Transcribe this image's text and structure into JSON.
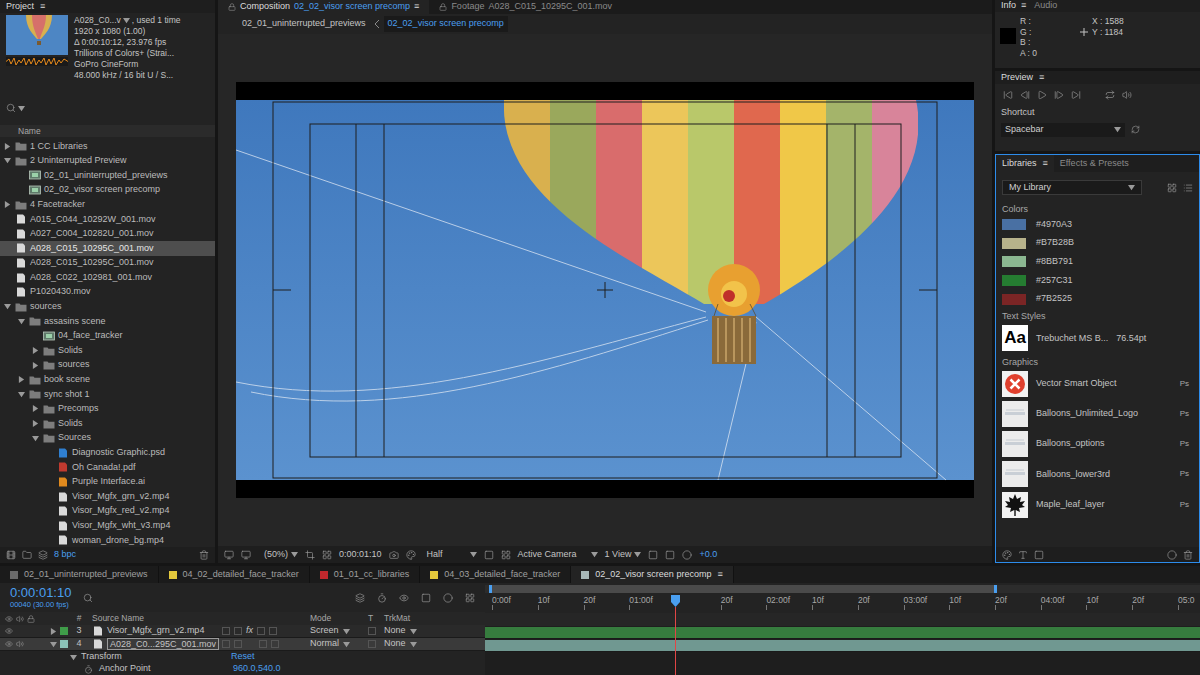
{
  "project": {
    "title": "Project",
    "menu": "≡",
    "preview": {
      "name": "A028_C0...v",
      "usage": ", used 1 time",
      "details": [
        "1920 x 1080 (1.00)",
        "Δ 0:00:10:12, 23.976 fps",
        "Trillions of Colors+ (Strai...",
        "GoPro CineForm",
        "48.000 kHz / 16 bit U / S..."
      ]
    },
    "column": "Name",
    "items": [
      {
        "label": "1 CC Libraries",
        "kind": "folder",
        "depth": 0,
        "expanded": false,
        "selected": false
      },
      {
        "label": "2 Uninterrupted Preview",
        "kind": "folder",
        "depth": 0,
        "expanded": true,
        "selected": false
      },
      {
        "label": "02_01_uninterrupted_previews",
        "kind": "comp",
        "depth": 1,
        "expanded": false,
        "selected": false
      },
      {
        "label": "02_02_visor screen precomp",
        "kind": "comp",
        "depth": 1,
        "expanded": false,
        "selected": false
      },
      {
        "label": "4 Facetracker",
        "kind": "folder",
        "depth": 0,
        "expanded": false,
        "selected": false
      },
      {
        "label": "A015_C044_10292W_001.mov",
        "kind": "footage",
        "depth": 0,
        "expanded": false,
        "selected": false
      },
      {
        "label": "A027_C004_10282U_001.mov",
        "kind": "footage",
        "depth": 0,
        "expanded": false,
        "selected": false
      },
      {
        "label": "A028_C015_10295C_001.mov",
        "kind": "footage",
        "depth": 0,
        "expanded": false,
        "selected": true
      },
      {
        "label": "A028_C015_10295C_001.mov",
        "kind": "footage",
        "depth": 0,
        "expanded": false,
        "selected": false
      },
      {
        "label": "A028_C022_102981_001.mov",
        "kind": "footage",
        "depth": 0,
        "expanded": false,
        "selected": false
      },
      {
        "label": "P1020430.mov",
        "kind": "footage",
        "depth": 0,
        "expanded": false,
        "selected": false
      },
      {
        "label": "sources",
        "kind": "folder",
        "depth": 0,
        "expanded": true,
        "selected": false
      },
      {
        "label": "assasins scene",
        "kind": "folder",
        "depth": 1,
        "expanded": true,
        "selected": false
      },
      {
        "label": "04_face_tracker",
        "kind": "comp",
        "depth": 2,
        "expanded": false,
        "selected": false
      },
      {
        "label": "Solids",
        "kind": "folder",
        "depth": 2,
        "expanded": false,
        "selected": false
      },
      {
        "label": "sources",
        "kind": "folder",
        "depth": 2,
        "expanded": false,
        "selected": false
      },
      {
        "label": "book scene",
        "kind": "folder",
        "depth": 1,
        "expanded": false,
        "selected": false
      },
      {
        "label": "sync shot 1",
        "kind": "folder",
        "depth": 1,
        "expanded": true,
        "selected": false
      },
      {
        "label": "Precomps",
        "kind": "folder",
        "depth": 2,
        "expanded": false,
        "selected": false
      },
      {
        "label": "Solids",
        "kind": "folder",
        "depth": 2,
        "expanded": false,
        "selected": false
      },
      {
        "label": "Sources",
        "kind": "folder",
        "depth": 2,
        "expanded": true,
        "selected": false
      },
      {
        "label": "Diagnostic Graphic.psd",
        "kind": "psd",
        "depth": 3,
        "expanded": false,
        "selected": false
      },
      {
        "label": "Oh Canada!.pdf",
        "kind": "pdf",
        "depth": 3,
        "expanded": false,
        "selected": false
      },
      {
        "label": "Purple Interface.ai",
        "kind": "ai",
        "depth": 3,
        "expanded": false,
        "selected": false
      },
      {
        "label": "Visor_Mgfx_grn_v2.mp4",
        "kind": "footage",
        "depth": 3,
        "expanded": false,
        "selected": false
      },
      {
        "label": "Visor_Mgfx_red_v2.mp4",
        "kind": "footage",
        "depth": 3,
        "expanded": false,
        "selected": false
      },
      {
        "label": "Visor_Mgfx_wht_v3.mp4",
        "kind": "footage",
        "depth": 3,
        "expanded": false,
        "selected": false
      },
      {
        "label": "woman_drone_bg.mp4",
        "kind": "footage",
        "depth": 3,
        "expanded": false,
        "selected": false
      }
    ],
    "bit_depth": "8 bpc"
  },
  "composition": {
    "tabs": [
      {
        "label": "Composition",
        "name": "02_02_visor screen precomp",
        "selected": true
      },
      {
        "label": "Footage",
        "name": "A028_C015_10295C_001.mov",
        "selected": false
      }
    ],
    "menu": "≡",
    "breadcrumbs": [
      {
        "label": "02_01_uninterrupted_previews",
        "selected": false
      },
      {
        "label": "02_02_visor screen precomp",
        "selected": true
      }
    ],
    "toolbar": {
      "zoom": "(50%)",
      "time": "0:00:01:10",
      "resolution": "Half",
      "camera": "Active Camera",
      "views": "1 View",
      "exposure": "+0.0"
    }
  },
  "info": {
    "tabs": [
      {
        "label": "Info",
        "selected": true
      },
      {
        "label": "Audio",
        "selected": false
      }
    ],
    "menu": "≡",
    "channels": [
      "R :",
      "G :",
      "B :",
      "A : 0"
    ],
    "position": [
      "X : 1588",
      "Y : 1184"
    ]
  },
  "preview": {
    "title": "Preview",
    "menu": "≡",
    "shortcut_label": "Shortcut",
    "shortcut": "Spacebar"
  },
  "libraries": {
    "tabs": [
      {
        "label": "Libraries",
        "selected": true
      },
      {
        "label": "Effects & Presets",
        "selected": false
      }
    ],
    "menu": "≡",
    "library": "My Library",
    "sections": {
      "colors": "Colors",
      "text_styles": "Text Styles",
      "graphics": "Graphics"
    },
    "colors": [
      {
        "label": "#4970A3",
        "color": "#4970A3"
      },
      {
        "label": "#B7B28B",
        "color": "#B7B28B"
      },
      {
        "label": "#8BB791",
        "color": "#8BB791"
      },
      {
        "label": "#257C31",
        "color": "#257C31"
      },
      {
        "label": "#7B2525",
        "color": "#7B2525"
      }
    ],
    "text_styles": [
      {
        "sample": "Aa",
        "name": "Trebuchet MS B...",
        "size": "76.54pt"
      }
    ],
    "graphics": [
      {
        "name": "Vector Smart Object",
        "badge": "Ps",
        "kind": "error"
      },
      {
        "name": "Balloons_Unlimited_Logo",
        "badge": "Ps",
        "kind": "light"
      },
      {
        "name": "Balloons_options",
        "badge": "Ps",
        "kind": "light"
      },
      {
        "name": "Balloons_lower3rd",
        "badge": "Ps",
        "kind": "light"
      },
      {
        "name": "Maple_leaf_layer",
        "badge": "Ps",
        "kind": "leaf"
      }
    ]
  },
  "timeline": {
    "tabs": [
      {
        "label": "02_01_uninterrupted_previews",
        "color": "#6a6a6a",
        "selected": false
      },
      {
        "label": "04_02_detailed_face_tracker",
        "color": "#e3c83c",
        "selected": false
      },
      {
        "label": "01_01_cc_libraries",
        "color": "#c0282d",
        "selected": false
      },
      {
        "label": "04_03_detailed_face_tracker",
        "color": "#e3c83c",
        "selected": false
      },
      {
        "label": "02_02_visor screen precomp",
        "color": "#a8b8b8",
        "selected": true
      }
    ],
    "menu": "≡",
    "time": "0:00:01:10",
    "frame": "00040 (30.00 fps)",
    "columns": {
      "number": "#",
      "source": "Source Name",
      "mode": "Mode",
      "track": "T",
      "matte": "TrkMat"
    },
    "effect_label": "fx",
    "layers": [
      {
        "number": "3",
        "name": "Visor_Mgfx_grn_v2.mp4",
        "mode": "Screen",
        "matte": "None",
        "color": "#3f9c49",
        "fx": true,
        "audio": false,
        "expanded": false,
        "selected": false
      },
      {
        "number": "4",
        "name": "A028_C0...295C_001.mov",
        "mode": "Normal",
        "matte": "None",
        "color": "#8cc2b8",
        "fx": false,
        "audio": true,
        "expanded": true,
        "selected": true
      }
    ],
    "properties": [
      {
        "label": "Transform",
        "value": "Reset",
        "kind": "group"
      },
      {
        "label": "Anchor Point",
        "value": "960.0,540.0",
        "kind": "property"
      }
    ],
    "ruler": [
      {
        "label": "0:00f",
        "t": 0
      },
      {
        "label": "10f",
        "t": 0.333
      },
      {
        "label": "20f",
        "t": 0.667
      },
      {
        "label": "01:00f",
        "t": 1
      },
      {
        "label": "20f",
        "t": 1.667
      },
      {
        "label": "02:00f",
        "t": 2
      },
      {
        "label": "10f",
        "t": 2.333
      },
      {
        "label": "20f",
        "t": 2.667
      },
      {
        "label": "03:00f",
        "t": 3
      },
      {
        "label": "10f",
        "t": 3.333
      },
      {
        "label": "20f",
        "t": 3.667
      },
      {
        "label": "04:00f",
        "t": 4
      },
      {
        "label": "10f",
        "t": 4.333
      },
      {
        "label": "20f",
        "t": 4.667
      },
      {
        "label": "05:0",
        "t": 5
      }
    ],
    "playhead": 1.333,
    "work_area_end": 3.67
  }
}
